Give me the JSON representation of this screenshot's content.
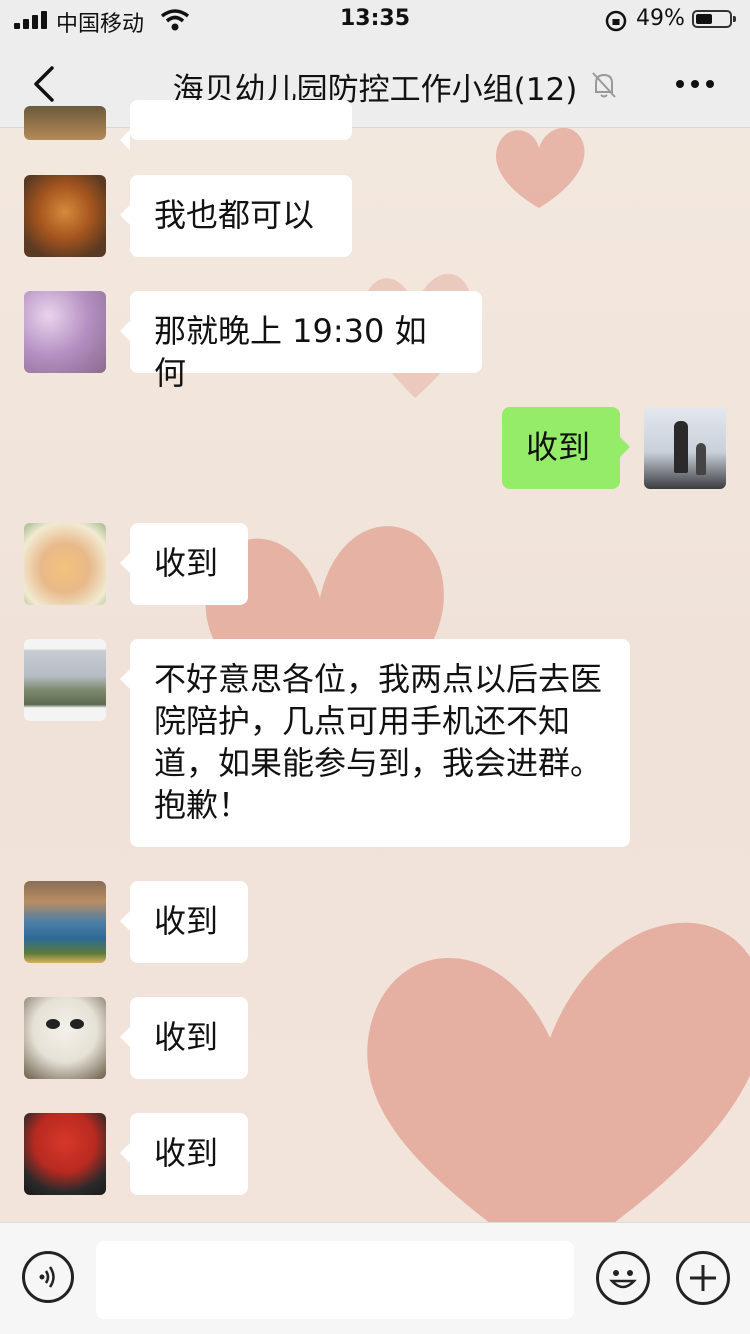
{
  "status_bar": {
    "carrier": "中国移动",
    "time": "13:35",
    "battery_percent": "49%",
    "battery_level": 0.49
  },
  "nav": {
    "title": "海贝幼儿园防控工作小组(12)",
    "back_icon": "chevron-left-icon",
    "mute_icon": "bell-slash-icon",
    "more_icon": "more-dots-icon"
  },
  "messages": [
    {
      "sender": "other",
      "text": "我也都可以"
    },
    {
      "sender": "other",
      "text": "那就晚上 19:30 如何"
    },
    {
      "sender": "me",
      "text": "收到"
    },
    {
      "sender": "other",
      "text": "收到"
    },
    {
      "sender": "other",
      "text": "不好意思各位，我两点以后去医院陪护，几点可用手机还不知道，如果能参与到，我会进群。抱歉！"
    },
    {
      "sender": "other",
      "text": "收到"
    },
    {
      "sender": "other",
      "text": "收到"
    },
    {
      "sender": "other",
      "text": "收到"
    }
  ],
  "input_bar": {
    "voice_icon": "voice-icon",
    "emoji_icon": "emoji-icon",
    "plus_icon": "plus-icon",
    "text_value": ""
  },
  "colors": {
    "my_bubble": "#95ec69",
    "other_bubble": "#ffffff",
    "bar_bg": "#ededed",
    "heart": "#e3a99a"
  }
}
